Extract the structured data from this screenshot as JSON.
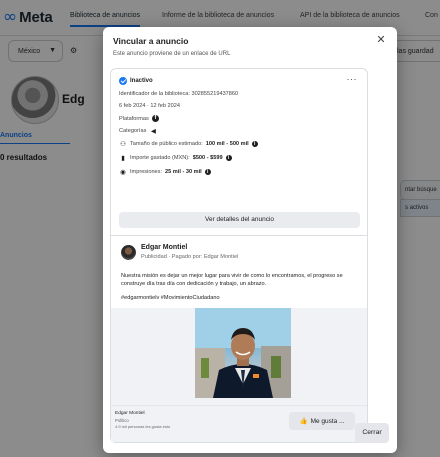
{
  "background": {
    "logo_text": "Meta",
    "nav": [
      "Biblioteca de anuncios",
      "Informe de la biblioteca de anuncios",
      "API de la biblioteca de anuncios",
      "Con"
    ],
    "country_filter": "México",
    "saved_partial": "las guardad",
    "page_name_partial": "Edg",
    "tab": "Anuncios",
    "results": "0 resultados",
    "side_button_1": "ntar búsque",
    "side_button_2": "s activos"
  },
  "modal": {
    "title": "Vincular a anuncio",
    "subtitle": "Este anuncio proviene de un enlace de URL",
    "close_icon": "✕",
    "card": {
      "status": "Inactivo",
      "more_icon": "···",
      "library_id": "Identificador de la biblioteca: 302855219437860",
      "dates": "6 feb 2024 · 12 feb 2024",
      "platforms_label": "Plataformas",
      "categories_label": "Categorías",
      "audience_label": "Tamaño de público estimado:",
      "audience_value": "100 mil - 500 mil",
      "spend_label": "Importe gastado (MXN):",
      "spend_value": "$500 - $599",
      "impressions_label": "Impresiones:",
      "impressions_value": "25 mil - 30 mil",
      "view_details": "Ver detalles del anuncio",
      "ad": {
        "page_name": "Edgar Montiel",
        "meta": "Publicidad · Pagado por: Edgar Montiel",
        "body": "Nuestra misión es dejar un mejor lugar para vivir de como lo encontramos, el progreso se construye día tras día con dedicación y trabajo, un abrazo.",
        "hashtags": "#edgarmontielv #MovimientoCiudadano",
        "cta_page_name": "Edgar Montiel",
        "cta_page_type": "Político",
        "cta_likes": "4.9 mil personas les gusta esto",
        "like_button": "Me gusta ..."
      }
    },
    "close_button": "Cerrar"
  },
  "colors": {
    "accent": "#1877f2",
    "overlay": "rgba(0,0,0,0.45)",
    "button_bg": "#e4e6eb"
  }
}
